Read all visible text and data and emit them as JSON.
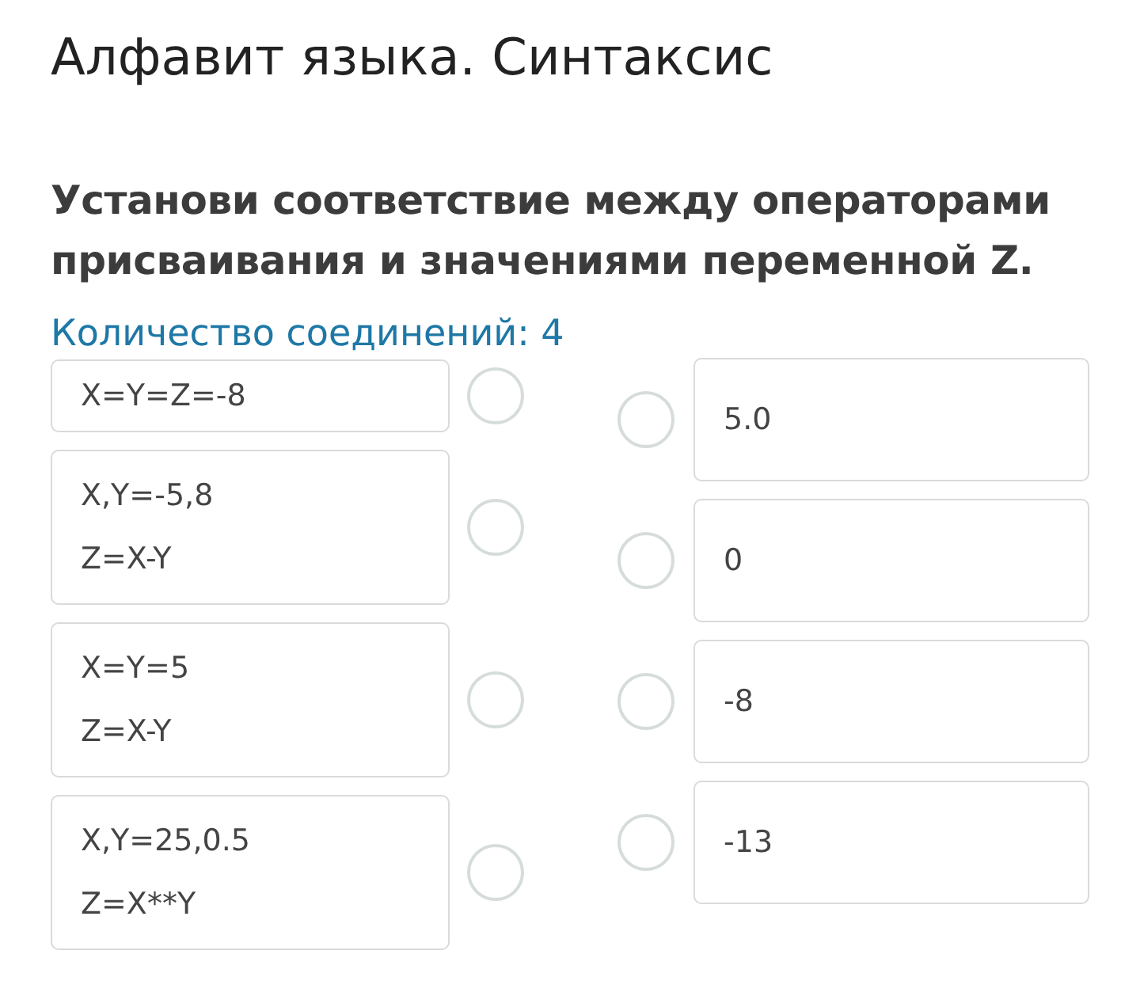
{
  "title": "Алфавит языка. Синтаксис",
  "question": "Установи соответствие между операторами присваивания и значениями переменной Z.",
  "connections_label": "Количество соединений: 4",
  "left_items": [
    {
      "lines": [
        "X=Y=Z=-8"
      ]
    },
    {
      "lines": [
        "X,Y=-5,8",
        "Z=X-Y"
      ]
    },
    {
      "lines": [
        "X=Y=5",
        "Z=X-Y"
      ]
    },
    {
      "lines": [
        "X,Y=25,0.5",
        "Z=X**Y"
      ]
    }
  ],
  "right_items": [
    {
      "text": "5.0"
    },
    {
      "text": "0"
    },
    {
      "text": "-8"
    },
    {
      "text": "-13"
    }
  ]
}
